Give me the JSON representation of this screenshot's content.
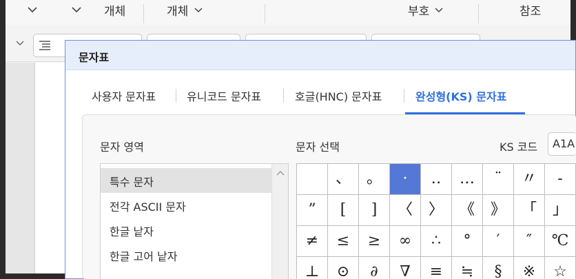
{
  "toolbar": {
    "top_items": [
      "개체",
      "개체",
      "부호",
      "참조"
    ]
  },
  "dialog": {
    "title": "문자표",
    "tabs": [
      "사용자 문자표",
      "유니코드 문자표",
      "호글(HNC) 문자표",
      "완성형(KS) 문자표"
    ],
    "active_tab": 3,
    "area_label": "문자 영역",
    "select_label": "문자 선택",
    "ks_label": "KS 코드",
    "ks_value": "A1A",
    "area_items": [
      "특수 문자",
      "전각 ASCII 문자",
      "한글 낱자",
      "한글 고어 낱자"
    ],
    "selected_area": 0,
    "chars": [
      [
        "",
        "、",
        "。",
        "·",
        "‥",
        "…",
        "¨",
        "〃",
        "-"
      ],
      [
        "\"",
        "[",
        "]",
        "〈",
        "〉",
        "《",
        "》",
        "「",
        "」"
      ],
      [
        "≠",
        "≤",
        "≥",
        "∞",
        "∴",
        "°",
        "′",
        "″",
        "℃"
      ],
      [
        "∠",
        "⊥",
        "⌒",
        "∂",
        "∇",
        "≡",
        "≒",
        "§",
        "※"
      ]
    ],
    "grid_display": [
      [
        "",
        "、",
        "。",
        "·",
        "‥",
        "…",
        "¨",
        "〃",
        "-"
      ],
      [
        "”",
        "[",
        "]",
        "〈",
        "〉",
        "《",
        "》",
        "「",
        "」"
      ],
      [
        "≠",
        "≤",
        "≥",
        "∞",
        "∴",
        "°",
        "′",
        "″",
        "℃"
      ],
      [
        "⊥",
        "⊙",
        "∂",
        "∇",
        "≡",
        "≒",
        "§",
        "※",
        "☆"
      ]
    ],
    "selected_cell": [
      0,
      3
    ]
  },
  "colors": {
    "accent": "#2f6fe0",
    "selected_cell": "#5577d6"
  }
}
